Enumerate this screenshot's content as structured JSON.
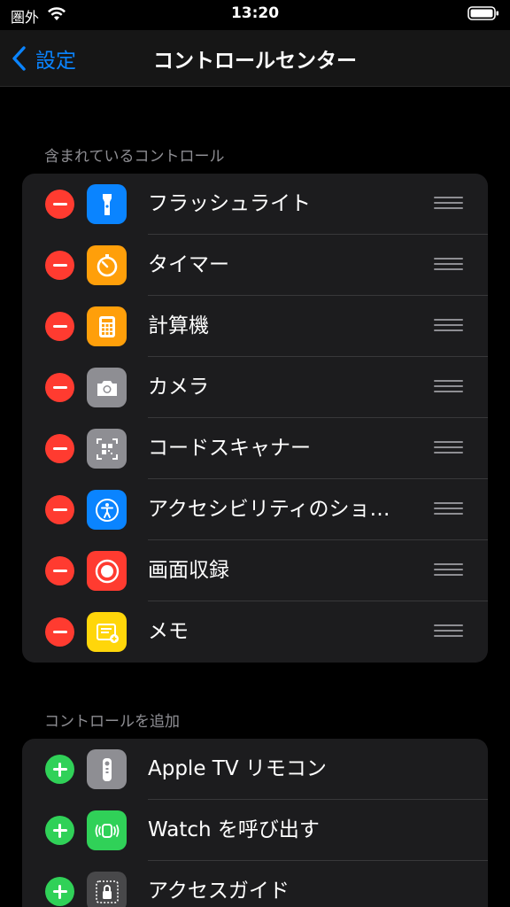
{
  "status_bar": {
    "carrier": "圏外",
    "time": "13:20"
  },
  "nav": {
    "back_label": "設定",
    "title": "コントロールセンター"
  },
  "included": {
    "header": "含まれているコントロール",
    "items": [
      {
        "label": "フラッシュライト",
        "icon": "flashlight-icon",
        "color": "#0a84ff"
      },
      {
        "label": "タイマー",
        "icon": "timer-icon",
        "color": "#ff9f0a"
      },
      {
        "label": "計算機",
        "icon": "calculator-icon",
        "color": "#ff9f0a"
      },
      {
        "label": "カメラ",
        "icon": "camera-icon",
        "color": "#8e8e93"
      },
      {
        "label": "コードスキャナー",
        "icon": "qr-code-icon",
        "color": "#8e8e93"
      },
      {
        "label": "アクセシビリティのショ…",
        "icon": "accessibility-icon",
        "color": "#0a84ff"
      },
      {
        "label": "画面収録",
        "icon": "screen-record-icon",
        "color": "#ff3b30"
      },
      {
        "label": "メモ",
        "icon": "notes-icon",
        "color": "#ffd60a"
      }
    ]
  },
  "more": {
    "header": "コントロールを追加",
    "items": [
      {
        "label": "Apple TV リモコン",
        "icon": "tv-remote-icon",
        "color": "#8e8e93"
      },
      {
        "label": "Watch を呼び出す",
        "icon": "watch-ping-icon",
        "color": "#30d158"
      },
      {
        "label": "アクセスガイド",
        "icon": "guided-access-icon",
        "color": "#48484a"
      }
    ]
  },
  "colors": {
    "accent": "#0a84ff",
    "remove": "#ff3b30",
    "add": "#30d158"
  }
}
